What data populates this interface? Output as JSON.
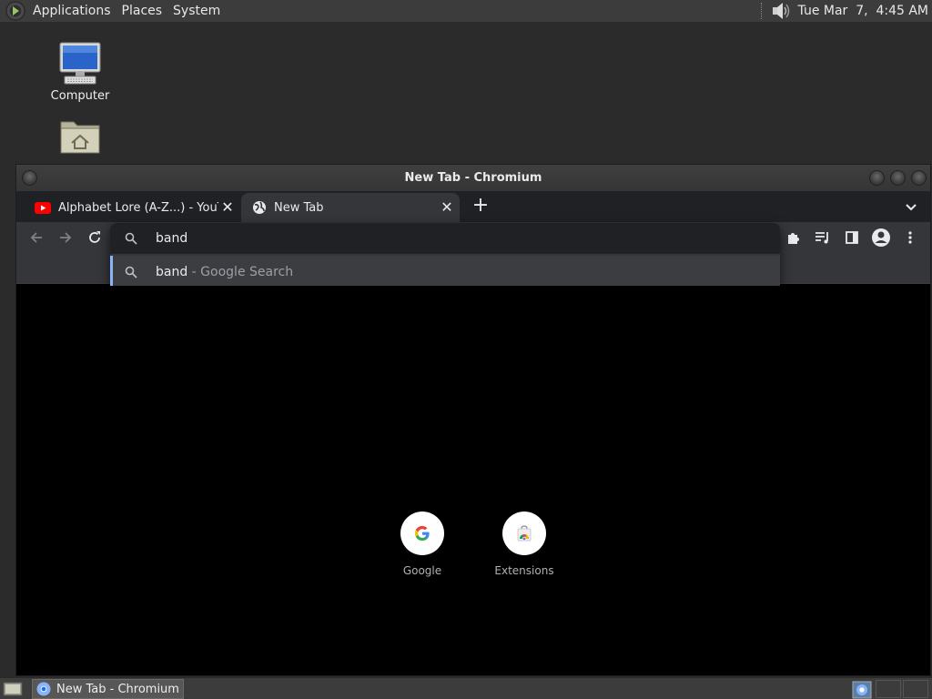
{
  "top_panel": {
    "menus": [
      "Applications",
      "Places",
      "System"
    ],
    "clock": "Tue Mar  7,  4:45 AM"
  },
  "desktop": {
    "icons": [
      {
        "label": "Computer",
        "icon": "computer-icon"
      },
      {
        "label": "",
        "icon": "home-folder-icon"
      }
    ]
  },
  "window": {
    "title": "New Tab - Chromium",
    "tabs": [
      {
        "title": "Alphabet Lore (A-Z...) - YouTube",
        "favicon": "youtube-icon",
        "active": false
      },
      {
        "title": "New Tab",
        "favicon": "globe-icon",
        "active": true
      }
    ],
    "omnibox": {
      "input_value": "band",
      "suggestion_query": "band",
      "suggestion_suffix": " - Google Search"
    },
    "shortcuts": [
      {
        "label": "Google",
        "icon": "google-icon"
      },
      {
        "label": "Extensions",
        "icon": "chrome-web-store-icon"
      }
    ]
  },
  "bottom_panel": {
    "task_label": "New Tab - Chromium"
  },
  "colors": {
    "accent": "#8ab4f8",
    "panel": "#3c3c3c",
    "desktop": "#2b2b2b"
  }
}
